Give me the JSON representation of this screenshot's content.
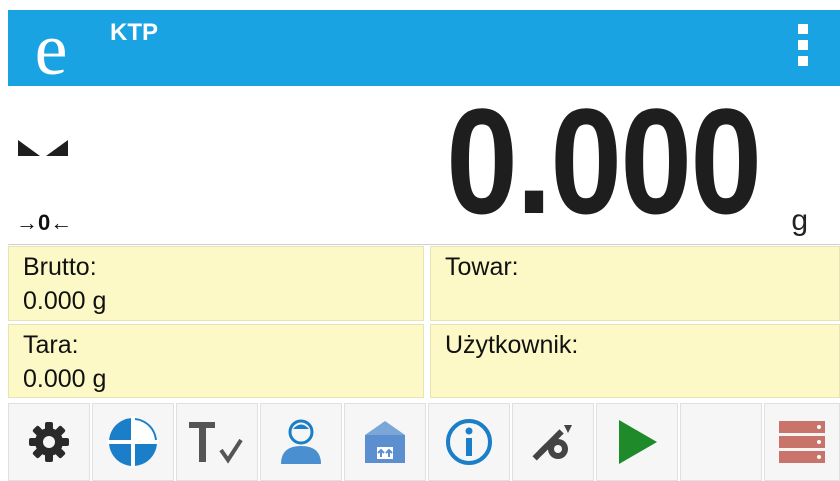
{
  "header": {
    "title": "KTP",
    "logo_letter": "e",
    "color": "#1aa3e3"
  },
  "readout": {
    "zero_indicator": "→0←",
    "value": "0.000",
    "unit": "g"
  },
  "info": {
    "brutto_label": "Brutto:",
    "brutto_value": "0.000 g",
    "towar_label": "Towar:",
    "towar_value": "",
    "tara_label": "Tara:",
    "tara_value": "0.000 g",
    "uzytkownik_label": "Użytkownik:",
    "uzytkownik_value": ""
  },
  "toolbar": {
    "icons": [
      "gear-icon",
      "chart-icon",
      "tare-check-icon",
      "user-icon",
      "package-icon",
      "info-icon",
      "tools-icon",
      "play-icon",
      "empty-slot",
      "database-icon"
    ]
  }
}
